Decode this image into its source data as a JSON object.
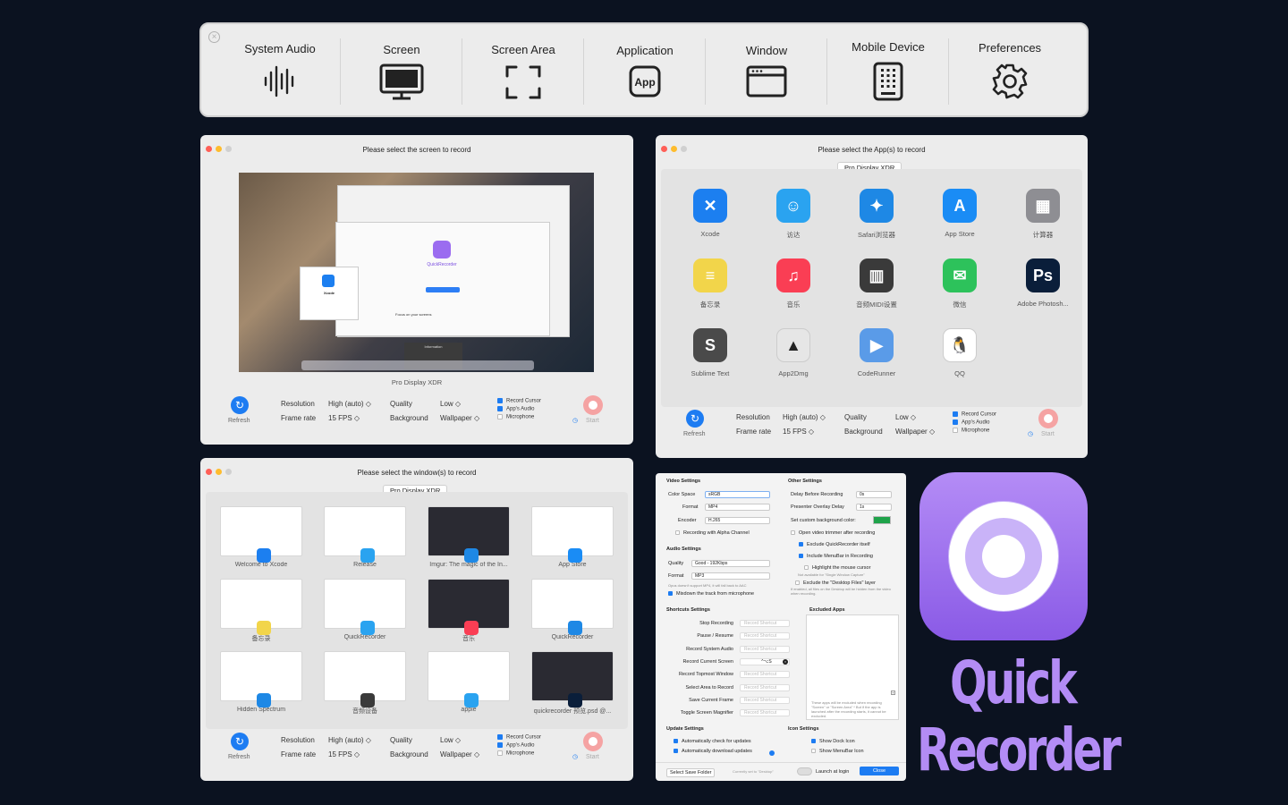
{
  "toolbar": {
    "items": [
      {
        "label": "System Audio",
        "icon": "waveform-icon"
      },
      {
        "label": "Screen",
        "icon": "display-icon"
      },
      {
        "label": "Screen Area",
        "icon": "crop-frame-icon"
      },
      {
        "label": "Application",
        "icon": "app-icon",
        "icon_text": "App"
      },
      {
        "label": "Window",
        "icon": "window-icon"
      },
      {
        "label": "Mobile Device",
        "icon": "mobile-device-icon"
      },
      {
        "label": "Preferences",
        "icon": "gear-icon"
      }
    ]
  },
  "screen_window": {
    "title": "Please select the screen to record",
    "display": "Pro Display XDR",
    "preview": {
      "app_name": "QuickRecorder",
      "xcode_label": "Xcode",
      "focus_text": "Focus on your screens",
      "info_label": "Information"
    }
  },
  "app_window": {
    "title": "Please select the App(s) to record",
    "display": "Pro Display XDR",
    "apps": [
      {
        "name": "Xcode",
        "color": "#1c7ff0",
        "glyph": "✕"
      },
      {
        "name": "访达",
        "color": "#2aa3f0",
        "glyph": "☺"
      },
      {
        "name": "Safari浏览器",
        "color": "#1e88e5",
        "glyph": "✦"
      },
      {
        "name": "App Store",
        "color": "#1a8cf5",
        "glyph": "A"
      },
      {
        "name": "计算器",
        "color": "#8e8e93",
        "glyph": "▦"
      },
      {
        "name": "备忘录",
        "color": "#f2d54a",
        "glyph": "≡"
      },
      {
        "name": "音乐",
        "color": "#fa3e54",
        "glyph": "♫"
      },
      {
        "name": "音频MIDI设置",
        "color": "#3a3a3a",
        "glyph": "▥"
      },
      {
        "name": "微信",
        "color": "#2dc25b",
        "glyph": "✉"
      },
      {
        "name": "Adobe Photosh...",
        "color": "#0a1e3a",
        "glyph": "Ps"
      },
      {
        "name": "Sublime Text",
        "color": "#4a4a4a",
        "glyph": "S"
      },
      {
        "name": "App2Dmg",
        "color": "#e6e6e6",
        "glyph": "▲"
      },
      {
        "name": "CodeRunner",
        "color": "#5a9be8",
        "glyph": "▶"
      },
      {
        "name": "QQ",
        "color": "#ffffff",
        "glyph": "🐧"
      }
    ]
  },
  "window_window": {
    "title": "Please select the window(s) to record",
    "display": "Pro Display XDR",
    "windows": [
      {
        "name": "Welcome to Xcode",
        "badge": "#1c7ff0",
        "dark": false
      },
      {
        "name": "Release",
        "badge": "#2aa3f0",
        "dark": false
      },
      {
        "name": "Imgur: The magic of the In...",
        "badge": "#1e88e5",
        "dark": true
      },
      {
        "name": "App Store",
        "badge": "#1a8cf5",
        "dark": false
      },
      {
        "name": "备忘录",
        "badge": "#f2d54a",
        "dark": false
      },
      {
        "name": "QuickRecorder",
        "badge": "#2aa3f0",
        "dark": false
      },
      {
        "name": "音乐",
        "badge": "#fa3e54",
        "dark": true
      },
      {
        "name": "QuickRecorder",
        "badge": "#1e88e5",
        "dark": false
      },
      {
        "name": "Hidden Spectrum",
        "badge": "#1e88e5",
        "dark": false
      },
      {
        "name": "音频设备",
        "badge": "#3a3a3a",
        "dark": false
      },
      {
        "name": "apple",
        "badge": "#2aa3f0",
        "dark": false
      },
      {
        "name": "quickrecorder 预览.psd @...",
        "badge": "#0a1e3a",
        "dark": true
      }
    ]
  },
  "footer": {
    "refresh": "Refresh",
    "resolution_label": "Resolution",
    "resolution_value": "High (auto) ◇",
    "framerate_label": "Frame rate",
    "framerate_value": "15 FPS ◇",
    "quality_label": "Quality",
    "quality_value": "Low ◇",
    "background_label": "Background",
    "background_value": "Wallpaper ◇",
    "record_cursor": "Record Cursor",
    "apps_audio": "App's Audio",
    "microphone": "Microphone",
    "start": "Start"
  },
  "prefs": {
    "video_settings": "Video Settings",
    "color_space_label": "Color Space",
    "color_space": "sRGB",
    "format_label": "Format",
    "format": "MP4",
    "encoder_label": "Encoder",
    "encoder": "H.265",
    "alpha": "Recording with Alpha Channel",
    "audio_settings": "Audio Settings",
    "quality_label": "Quality",
    "quality": "Good - 192Kbps",
    "audio_format_label": "Format",
    "audio_format": "MP3",
    "opus_note": "Opus doesn't support MP4, it will fall back to AAC",
    "mixdown": "Mixdown the track from microphone",
    "other_settings": "Other Settings",
    "delay_label": "Delay Before Recording",
    "delay": "0s",
    "overlay_label": "Presenter Overlay Delay",
    "overlay": "1s",
    "bg_color_label": "Set custom background color:",
    "bg_color": "#1fa34a",
    "open_trimmer": "Open video trimmer after recording",
    "exclude_qr": "Exclude QuickRecorder itself",
    "include_menubar": "Include MenuBar in Recording",
    "highlight_cursor": "Highlight the mouse cursor",
    "highlight_note": "Not available for \"Single Window Capture\"",
    "exclude_desktop": "Exclude the \"Desktop Files\" layer",
    "desktop_note": "If enabled, all files on the Desktop will be hidden from the video when recording.",
    "shortcuts_settings": "Shortcuts Settings",
    "shortcut_placeholder": "Record Shortcut",
    "shortcuts": [
      {
        "label": "Stop Recording",
        "value": ""
      },
      {
        "label": "Pause / Resume",
        "value": ""
      },
      {
        "label": "Record System Audio",
        "value": ""
      },
      {
        "label": "Record Current Screen",
        "value": "^⌥S"
      },
      {
        "label": "Record Topmost Window",
        "value": ""
      },
      {
        "label": "Select Area to Record",
        "value": ""
      },
      {
        "label": "Save Current Frame",
        "value": ""
      },
      {
        "label": "Toggle Screen Magnifier",
        "value": ""
      }
    ],
    "excluded_apps": "Excluded Apps",
    "excluded_note": "These apps will be excluded when recording \"Screen\" or \"Screen Area\" * But if the app is launched after the recording starts, it cannot be excluded.",
    "update_settings": "Update Settings",
    "auto_check": "Automatically check for updates",
    "auto_download": "Automatically download updates",
    "icon_settings": "Icon Settings",
    "show_dock": "Show Dock Icon",
    "show_menubar": "Show MenuBar Icon",
    "save_folder": "Select Save Folder",
    "current_set": "Currently set to \"Desktop\"",
    "launch_login": "Launch at login",
    "close": "Close"
  },
  "logo": {
    "line1": "Quick",
    "line2": "Recorder",
    "accent": "#b38cf5"
  }
}
